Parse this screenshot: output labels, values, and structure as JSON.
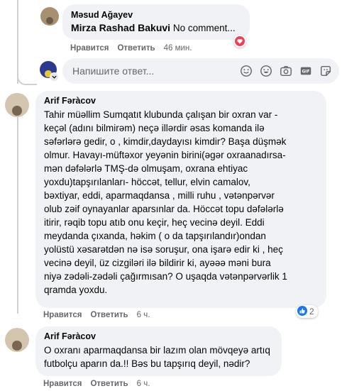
{
  "top_reply": {
    "author": "Məsud Ağayev",
    "mention": "Mirza Rashad Bakuvi",
    "text": "No comment...",
    "like_label": "Нравится",
    "reply_label": "Ответить",
    "time": "46 мин."
  },
  "reply_box": {
    "placeholder": "Напишите ответ...",
    "icons": [
      "smiley-icon",
      "emoji-icon",
      "camera-icon",
      "gif-icon",
      "sticker-icon"
    ]
  },
  "comment1": {
    "author": "Arif Fəràcov",
    "lines": [
      "Tahir müəllim Sumqatıt klubunda çalışan bir oxran var -",
      "keçəl (adını bilmirəm) neçə illərdir əsas komanda ilə",
      "səfərlərə gedir, o , kimdir,daydayısı kimdir? Başa düşmək",
      "olmur. Havayı-müftəxor yeyənin birini(əgər oxraanadırsa-",
      "mən dəfələrlə TMŞ-də olmuşam, oxrana ehtiyac",
      "yoxdu)tapşırılanları- höccət, tellur, elvin camalov,",
      "bəxtiyar, eddi, aparmaqdansa , milli ruhu , vətənpərvər",
      "olub zəif oynayanlar aparsınlar da. Höccət topu dəfələrlə",
      "itirir, rəqib topu atıb onu keçir, heç vecinə deyil. Eddi",
      "meydanda çıxanda, həkim ( o da tapşırılandır)ondan",
      "yolüstü xəsarətdən nə isə soruşur, ona işarə edir ki , heç",
      "vecinə deyil, üz cizgiləri ilə bildirir ki, ayəəə məni bura",
      "niyə zədəli-zədəli çağırmısan? O uşaqda vətənpərvərlik 1",
      "qramda yoxdu."
    ],
    "like_label": "Нравится",
    "reply_label": "Ответить",
    "time": "6 ч.",
    "reaction_count": "2"
  },
  "comment2": {
    "author": "Arif Fəràcov",
    "lines": [
      "O oxranı aparmaqdansa bir lazım olan mövqeyə artıq",
      "futbolçu aparın da.!! Bəs bu tapşırıq deyil, nədir?"
    ],
    "like_label": "Нравится",
    "reply_label": "Ответить",
    "time": "6 ч."
  },
  "colors": {
    "bubble": "#f0f2f5",
    "meta": "#65676b",
    "like_blue": "#1877f2",
    "heart_red": "#f33e58"
  }
}
